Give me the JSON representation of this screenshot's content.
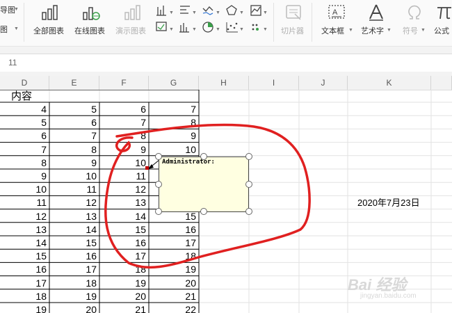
{
  "ribbon": {
    "partial_top_left": "导图",
    "partial_bottom_left": "图",
    "buttons": {
      "all_charts": "全部图表",
      "online_charts": "在线图表",
      "demo_charts": "演示图表",
      "slicer": "切片器",
      "text_box": "文本框",
      "art_text": "艺术字",
      "symbol": "符号",
      "formula": "公式"
    }
  },
  "formula_bar": {
    "value": "11"
  },
  "columns": [
    "D",
    "E",
    "F",
    "G",
    "H",
    "I",
    "J",
    "K"
  ],
  "sheet": {
    "header_cell": "内容",
    "rows": [
      [
        "4",
        "5",
        "6",
        "7"
      ],
      [
        "5",
        "6",
        "7",
        "8"
      ],
      [
        "6",
        "7",
        "8",
        "9"
      ],
      [
        "7",
        "8",
        "9",
        "10"
      ],
      [
        "8",
        "9",
        "10",
        ""
      ],
      [
        "9",
        "10",
        "11",
        ""
      ],
      [
        "10",
        "11",
        "12",
        ""
      ],
      [
        "11",
        "12",
        "13",
        ""
      ],
      [
        "12",
        "13",
        "14",
        "15"
      ],
      [
        "13",
        "14",
        "15",
        "16"
      ],
      [
        "14",
        "15",
        "16",
        "17"
      ],
      [
        "15",
        "16",
        "17",
        "18"
      ],
      [
        "16",
        "17",
        "18",
        "19"
      ],
      [
        "17",
        "18",
        "19",
        "20"
      ],
      [
        "18",
        "19",
        "20",
        "21"
      ],
      [
        "19",
        "20",
        "21",
        "22"
      ]
    ],
    "date_cell": "2020年7月23日"
  },
  "comment": {
    "author": "Administrator:"
  },
  "annotation": {
    "color": "#e02020"
  },
  "watermark": {
    "text": "Bai 经验",
    "sub": "jingyan.baidu.com"
  }
}
